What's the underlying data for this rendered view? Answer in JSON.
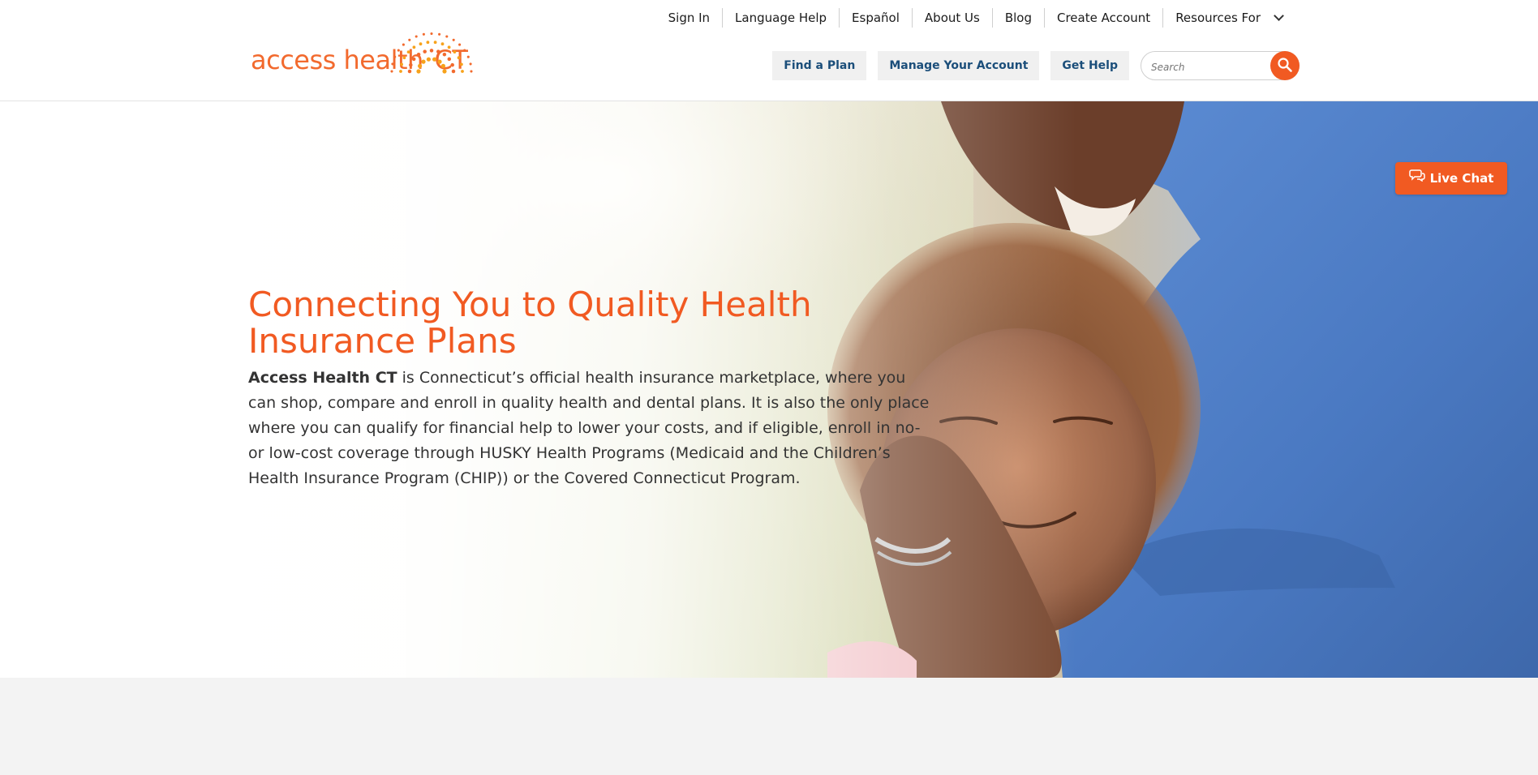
{
  "brand": {
    "name": "access health",
    "suffix": "CT",
    "color": "#f15a22"
  },
  "utility_nav": {
    "items": [
      "Sign In",
      "Language Help",
      "Español",
      "About Us",
      "Blog",
      "Create Account",
      "Resources For"
    ]
  },
  "main_nav": {
    "items": [
      "Find a Plan",
      "Manage Your Account",
      "Get Help"
    ],
    "text_color": "#1b4e7a"
  },
  "search": {
    "placeholder": "Search"
  },
  "live_chat": {
    "label": "Live Chat"
  },
  "hero": {
    "title": "Connecting You to Quality Health Insurance Plans",
    "body_lead": "Access Health CT",
    "body_rest": " is Connecticut’s official health insurance marketplace, where you can shop, compare and enroll in quality health and dental plans. It is also the only place where you can qualify for financial help to lower your costs, and if eligible, enroll in no- or low-cost coverage through HUSKY Health Programs (Medicaid and the Children’s Health Insurance Program (CHIP)) or the Covered Connecticut Program."
  },
  "icons": {
    "search": "search-icon",
    "chat": "chat-bubble-icon",
    "dropdown": "chevron-down-icon",
    "logo_sun": "sunburst-logo-icon"
  }
}
